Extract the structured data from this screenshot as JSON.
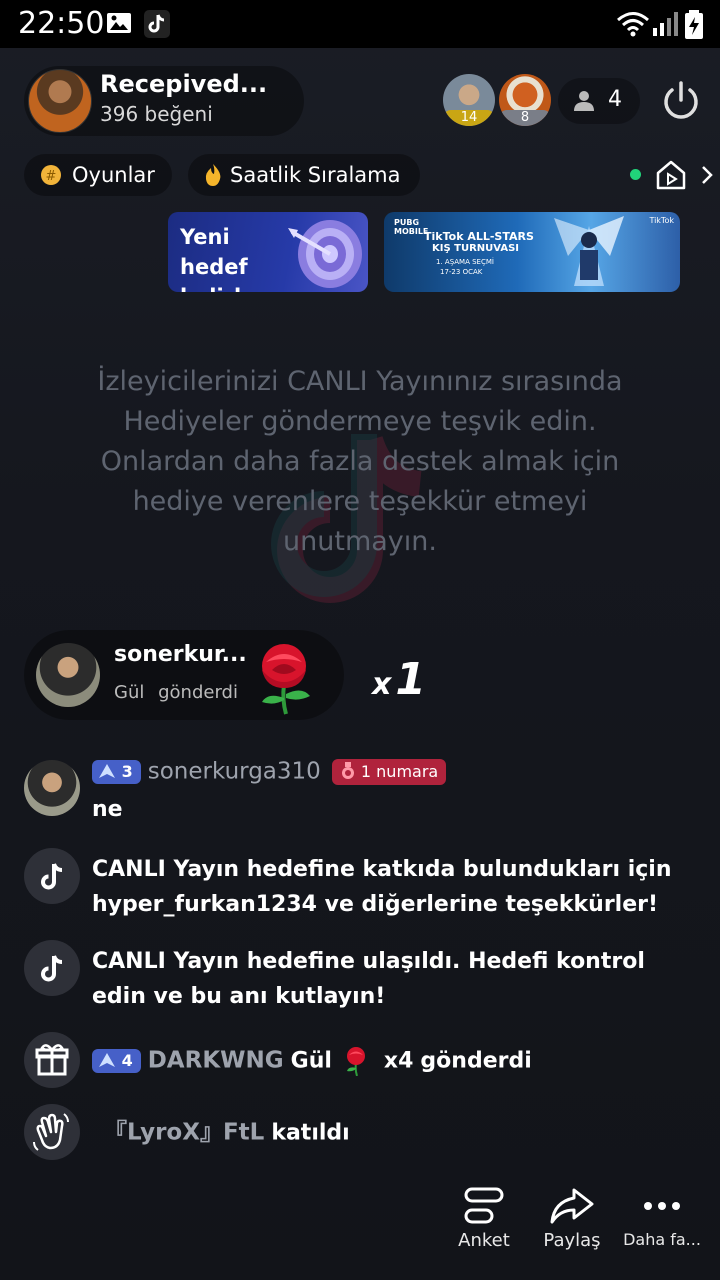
{
  "status_bar": {
    "time": "22:50"
  },
  "host": {
    "name": "Recepived...",
    "likes": "396 beğeni"
  },
  "viewers": [
    {
      "badge": "14",
      "badge_color": "#c9a614"
    },
    {
      "badge": "8",
      "badge_color": "#7a7e88"
    }
  ],
  "viewer_count": "4",
  "chips": {
    "games": "Oyunlar",
    "ranking": "Saatlik Sıralama"
  },
  "goal_banner": {
    "line1": "Yeni hedef",
    "line2": "belirle"
  },
  "promo_banner": {
    "brand": "PUBG MOBILE",
    "title": "TikTok ALL-STARS",
    "subtitle": "KIŞ TURNUVASI",
    "stage": "1. AŞAMA SEÇMİ",
    "dates": "17-23 OCAK",
    "corner": "TikTok"
  },
  "hint_text": "İzleyicilerinizi CANLI Yayınınız sırasında Hediyeler göndermeye teşvik edin. Onlardan daha fazla destek almak için hediye verenlere teşekkür etmeyi unutmayın.",
  "gift_notification": {
    "user": "sonerkur...",
    "gift_name": "Gül",
    "action": "gönderdi",
    "multiplier_x": "x",
    "multiplier_n": "1"
  },
  "chat": [
    {
      "type": "comment",
      "level": "3",
      "user": "sonerkurga310",
      "rank": "1 numara",
      "text": "ne"
    },
    {
      "type": "system",
      "text": "CANLI Yayın hedefine katkıda bulundukları için hyper_furkan1234 ve diğerlerine teşekkürler!"
    },
    {
      "type": "system",
      "text": "CANLI Yayın hedefine ulaşıldı. Hedefi kontrol edin ve bu anı kutlayın!"
    },
    {
      "type": "gift",
      "level": "4",
      "user": "DARKWNG",
      "gift": "Gül",
      "count": "x4",
      "verb": "gönderdi"
    },
    {
      "type": "join",
      "user": "『LyroX』FtL",
      "verb": "katıldı"
    }
  ],
  "actions": {
    "poll": "Anket",
    "share": "Paylaş",
    "more": "Daha fa..."
  },
  "colors": {
    "background": "#14161d",
    "level_badge": "#4660c8",
    "rank_badge": "#b0233c",
    "live_dot": "#21d47a"
  },
  "icons": [
    "image-icon",
    "tiktok-notif-icon",
    "wifi-icon",
    "signal-icon",
    "battery-icon",
    "person-icon",
    "power-icon",
    "home-play-icon",
    "chevron-right-icon",
    "target-icon",
    "tiktok-logo-icon",
    "rose-icon",
    "gift-icon",
    "wave-hand-icon",
    "poll-icon",
    "share-icon",
    "more-icon"
  ]
}
